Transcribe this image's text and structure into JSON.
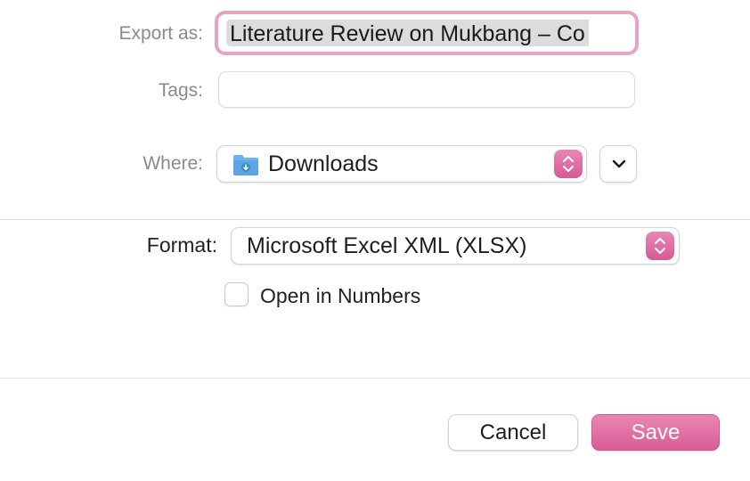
{
  "export_as": {
    "label": "Export as:",
    "value": "Literature Review on Mukbang – Co"
  },
  "tags": {
    "label": "Tags:",
    "value": ""
  },
  "where": {
    "label": "Where:",
    "value": "Downloads",
    "icon": "folder-downloads-icon",
    "expand_icon": "chevron-down-icon"
  },
  "format": {
    "label": "Format:",
    "value": "Microsoft Excel XML (XLSX)"
  },
  "open_in_numbers": {
    "label": "Open in Numbers",
    "checked": false
  },
  "buttons": {
    "cancel": "Cancel",
    "save": "Save"
  },
  "colors": {
    "accent": "#d65a95",
    "focus_ring": "#e6a3c3",
    "folder_blue": "#5aa5e6"
  }
}
